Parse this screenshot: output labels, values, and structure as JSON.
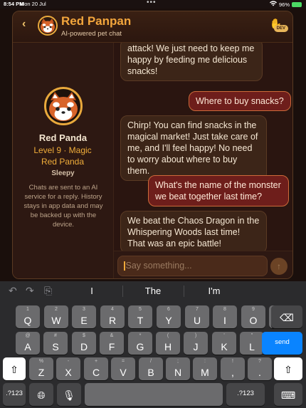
{
  "status_bar": {
    "time": "8:54 PM",
    "date": "Mon 20 Jul",
    "battery": "96%"
  },
  "header": {
    "title": "Red Panpan",
    "subtitle": "AI-powered pet chat",
    "dev_badge": "DEV"
  },
  "pet": {
    "name": "Red Panda",
    "level": "Level 9 · Magic Red Panda",
    "mood": "Sleepy",
    "privacy_note": "Chats are sent to an AI service for a reply. History stays in app data and may be backed up with the device."
  },
  "messages": [
    {
      "from": "pet",
      "text": "attack! We just need to keep me happy by feeding me delicious snacks!"
    },
    {
      "from": "user",
      "text": "Where to buy snacks?"
    },
    {
      "from": "pet",
      "text": "Chirp! You can find snacks in the magical market! Just take care of me, and I'll feel happy! No need to worry about where to buy them."
    },
    {
      "from": "user",
      "text": "What's the name of the monster we beat together last time?"
    },
    {
      "from": "pet",
      "text": "We beat the Chaos Dragon in the Whispering Woods last time! That was an epic battle!"
    }
  ],
  "input": {
    "placeholder": "Say something..."
  },
  "keyboard": {
    "suggestions": [
      "I",
      "The",
      "I'm"
    ],
    "row1": [
      {
        "main": "Q",
        "sub": "1"
      },
      {
        "main": "W",
        "sub": "2"
      },
      {
        "main": "E",
        "sub": "3"
      },
      {
        "main": "R",
        "sub": "4"
      },
      {
        "main": "T",
        "sub": "5"
      },
      {
        "main": "Y",
        "sub": "6"
      },
      {
        "main": "U",
        "sub": "7"
      },
      {
        "main": "I",
        "sub": "8"
      },
      {
        "main": "O",
        "sub": "9"
      },
      {
        "main": "P",
        "sub": "0"
      }
    ],
    "row2": [
      {
        "main": "A",
        "sub": "@"
      },
      {
        "main": "S",
        "sub": "#"
      },
      {
        "main": "D",
        "sub": "$"
      },
      {
        "main": "F",
        "sub": "&"
      },
      {
        "main": "G",
        "sub": "*"
      },
      {
        "main": "H",
        "sub": "("
      },
      {
        "main": "J",
        "sub": ")"
      },
      {
        "main": "K",
        "sub": "'"
      },
      {
        "main": "L",
        "sub": "\""
      }
    ],
    "row3": [
      {
        "main": "Z",
        "sub": "%"
      },
      {
        "main": "X",
        "sub": "-"
      },
      {
        "main": "C",
        "sub": "+"
      },
      {
        "main": "V",
        "sub": "="
      },
      {
        "main": "B",
        "sub": "/"
      },
      {
        "main": "N",
        "sub": ";"
      },
      {
        "main": "M",
        "sub": ":"
      },
      {
        "main": ",",
        "sub": "!"
      },
      {
        "main": ".",
        "sub": "?"
      }
    ],
    "send_label": "send",
    "numbers_label": ".?123"
  }
}
